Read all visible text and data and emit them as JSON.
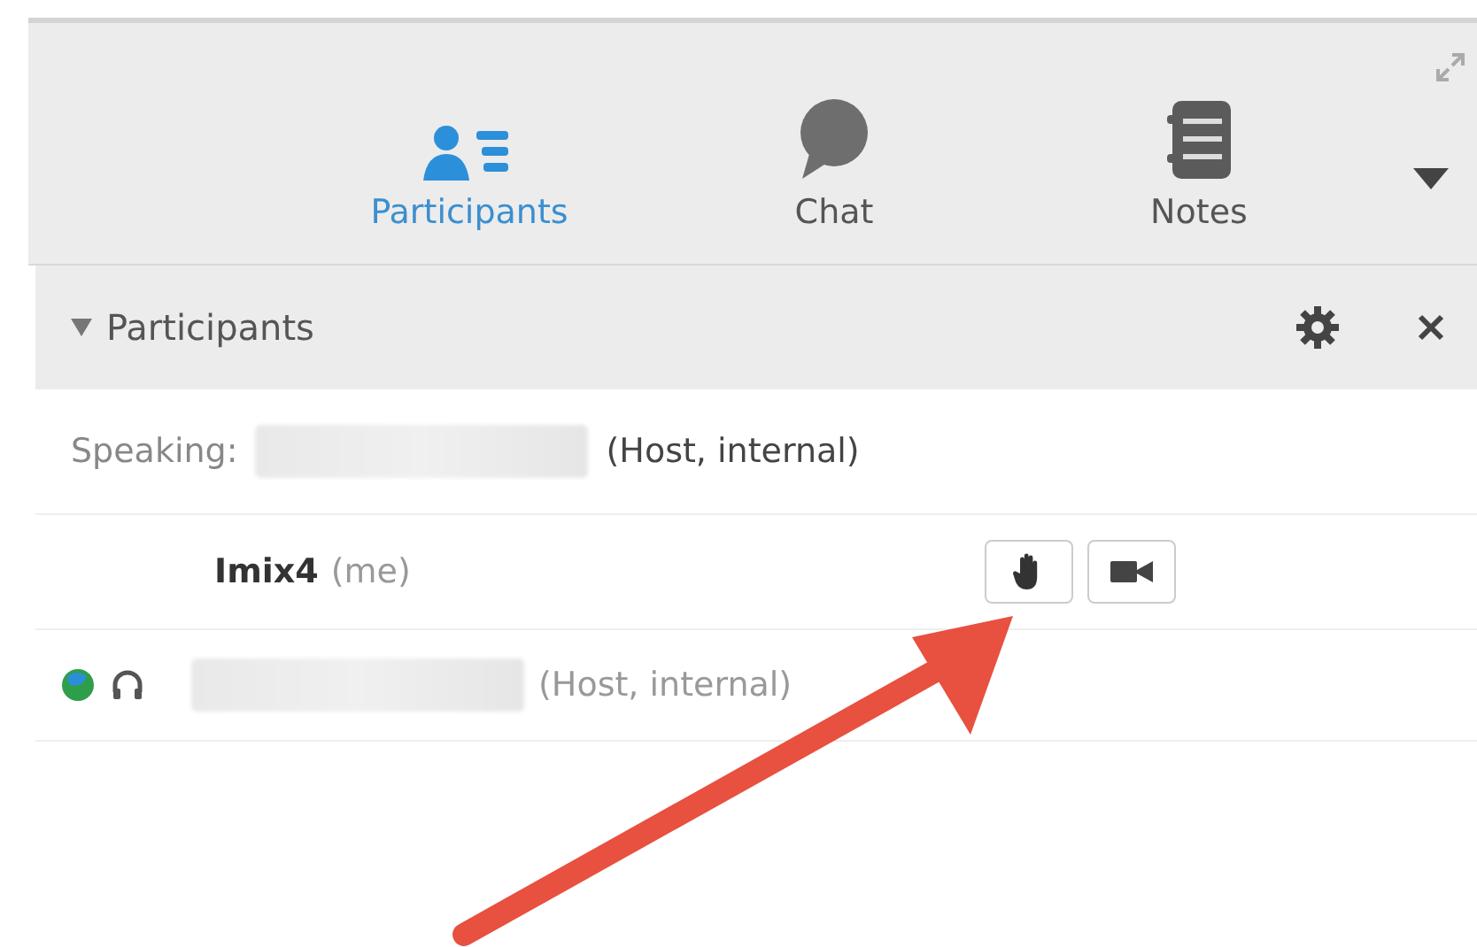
{
  "tabs": [
    {
      "label": "Participants",
      "kind": "people",
      "selected": true
    },
    {
      "label": "Chat",
      "kind": "chat",
      "selected": false
    },
    {
      "label": "Notes",
      "kind": "notes",
      "selected": false
    }
  ],
  "panel": {
    "title": "Participants",
    "expanded": true
  },
  "speaking": {
    "label": "Speaking:",
    "role": "(Host, internal)"
  },
  "participants": [
    {
      "name": "Imix4",
      "suffix": "(me)",
      "kind": "me"
    },
    {
      "suffix": "(Host, internal)",
      "kind": "host"
    }
  ]
}
